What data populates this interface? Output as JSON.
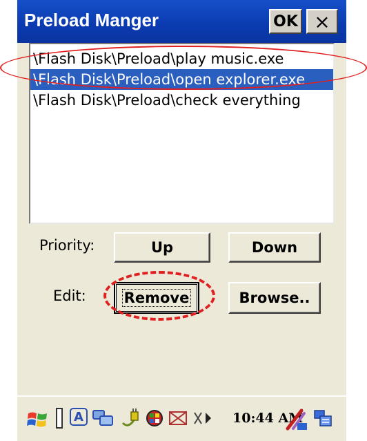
{
  "window": {
    "title": "Preload Manger",
    "ok_label": "OK",
    "close_glyph": "×"
  },
  "preload_list": {
    "items": [
      "\\Flash Disk\\Preload\\play music.exe",
      "\\Flash Disk\\Preload\\open explorer.exe",
      "\\Flash Disk\\Preload\\check everything"
    ],
    "selected_index": 1
  },
  "priority": {
    "label": "Priority:",
    "up_label": "Up",
    "down_label": "Down"
  },
  "edit": {
    "label": "Edit:",
    "remove_label": "Remove",
    "browse_label": "Browse.."
  },
  "taskbar": {
    "start_icon": "windows-flag-icon",
    "ime_label": "A",
    "time": "10:44 AM"
  },
  "annotations": {
    "ellipse_color": "#e02020"
  }
}
